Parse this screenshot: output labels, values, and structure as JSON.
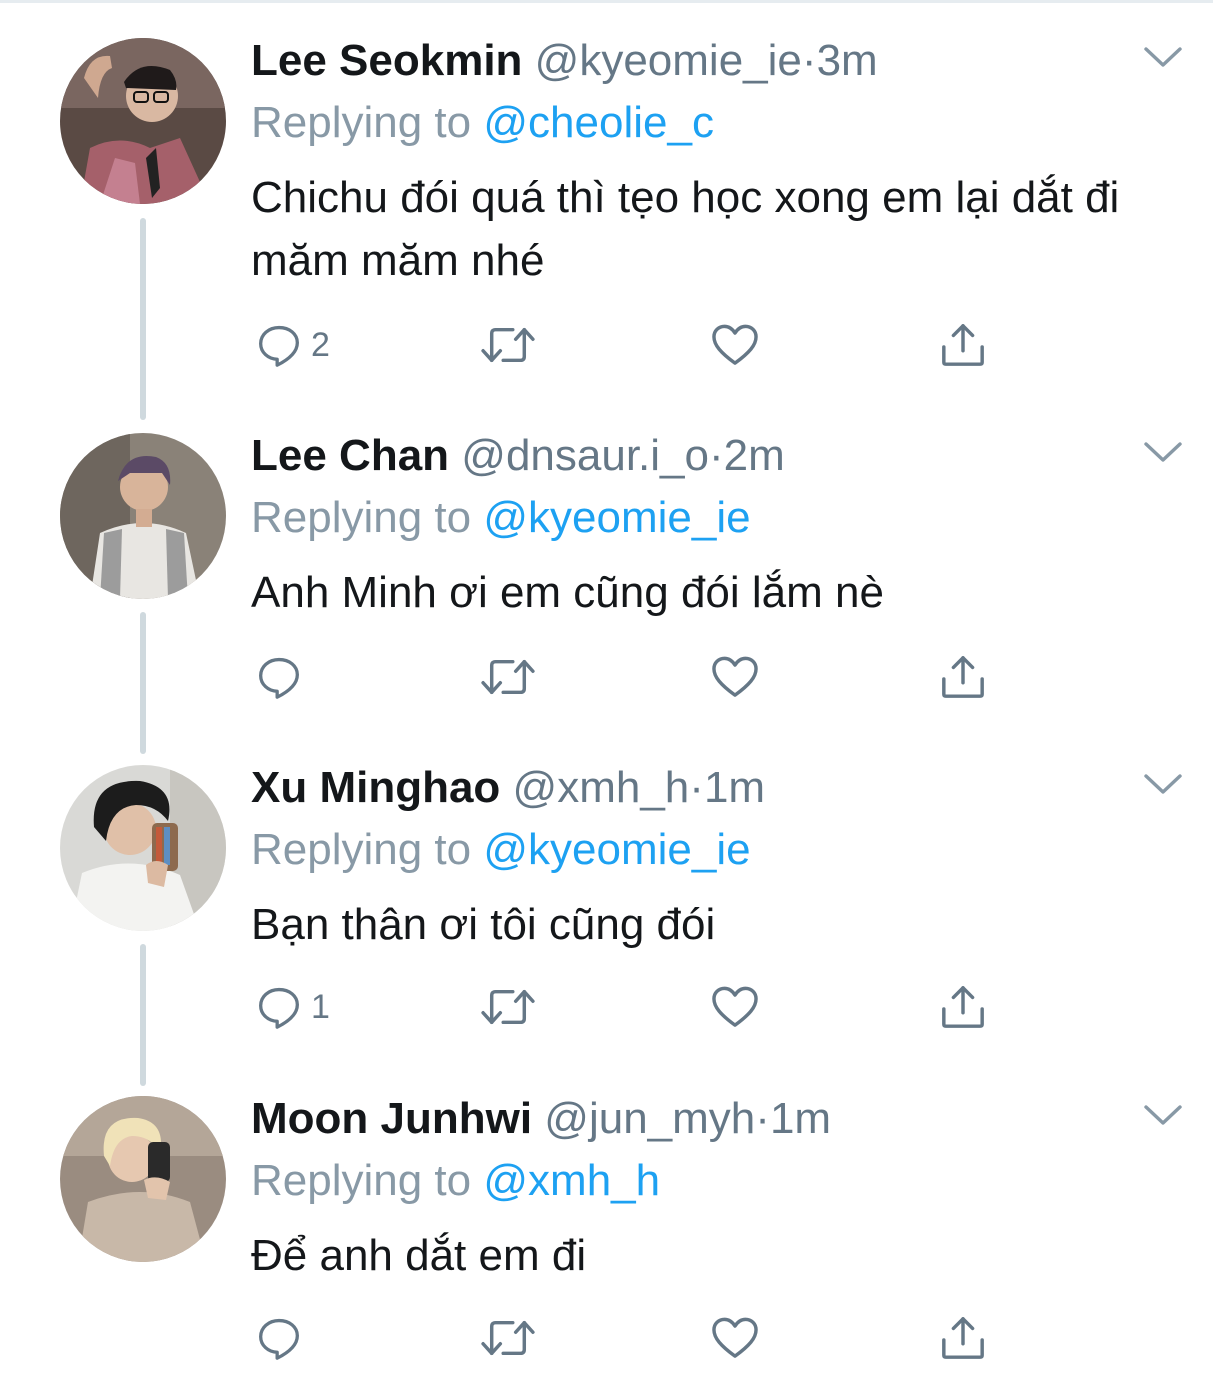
{
  "colors": {
    "text": "#14171a",
    "secondary": "#657786",
    "accent": "#1da1f2",
    "thread_line": "#cfd9de"
  },
  "tweets": [
    {
      "name": "Lee Seokmin",
      "handle": "@kyeomie_ie",
      "dot": "·",
      "time": "3m",
      "replying_label": "Replying to",
      "replying_to": "@cheolie_c",
      "text": "Chichu đói quá thì tẹo học xong em lại dắt đi măm măm nhé",
      "reply_count": "2",
      "icons": [
        "reply-icon",
        "retweet-icon",
        "like-icon",
        "share-icon",
        "chevron-down-icon"
      ]
    },
    {
      "name": "Lee Chan",
      "handle": "@dnsaur.i_o",
      "dot": "·",
      "time": "2m",
      "replying_label": "Replying to",
      "replying_to": "@kyeomie_ie",
      "text": "Anh Minh ơi em cũng đói lắm nè",
      "reply_count": "",
      "icons": [
        "reply-icon",
        "retweet-icon",
        "like-icon",
        "share-icon",
        "chevron-down-icon"
      ]
    },
    {
      "name": "Xu Minghao",
      "handle": "@xmh_h",
      "dot": "·",
      "time": "1m",
      "replying_label": "Replying to",
      "replying_to": "@kyeomie_ie",
      "text": "Bạn thân ơi tôi cũng đói",
      "reply_count": "1",
      "icons": [
        "reply-icon",
        "retweet-icon",
        "like-icon",
        "share-icon",
        "chevron-down-icon"
      ]
    },
    {
      "name": "Moon Junhwi",
      "handle": "@jun_myh",
      "dot": "·",
      "time": "1m",
      "replying_label": "Replying to",
      "replying_to": "@xmh_h",
      "text": "Để anh dắt em đi",
      "reply_count": "",
      "icons": [
        "reply-icon",
        "retweet-icon",
        "like-icon",
        "share-icon",
        "chevron-down-icon"
      ]
    }
  ]
}
